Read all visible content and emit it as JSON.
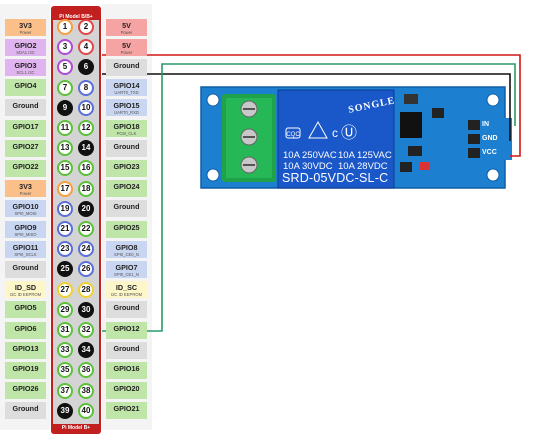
{
  "header": {
    "model": "Pi Model B/B+"
  },
  "footer": {
    "model": "Pi Model B+"
  },
  "pins": [
    {
      "l": "3V3",
      "ls": "Power",
      "r": "5V",
      "rs": "Power",
      "lc": "#fbbf8a",
      "rc": "#f6a3a3",
      "lp": "#f5a040",
      "rp": "#e14747",
      "ld": false,
      "rd": false
    },
    {
      "l": "GPIO2",
      "ls": "SDA1 I2C",
      "r": "5V",
      "rs": "Power",
      "lc": "#e0b4ee",
      "rc": "#f6a3a3",
      "lp": "#b24ad6",
      "rp": "#e14747",
      "ld": false,
      "rd": false
    },
    {
      "l": "GPIO3",
      "ls": "SCL1 I2C",
      "r": "Ground",
      "rs": "",
      "lc": "#e0b4ee",
      "rc": "#dddddd",
      "lp": "#b24ad6",
      "rp": "#111111",
      "ld": false,
      "rd": true
    },
    {
      "l": "GPIO4",
      "ls": "",
      "r": "GPIO14",
      "rs": "UART0_TXD",
      "lc": "#bfe6a8",
      "rc": "#c9d6f2",
      "lp": "#5cc13a",
      "rp": "#5a6fd8",
      "ld": false,
      "rd": false
    },
    {
      "l": "Ground",
      "ls": "",
      "r": "GPIO15",
      "rs": "UART0_RXD",
      "lc": "#dddddd",
      "rc": "#c9d6f2",
      "lp": "#111111",
      "rp": "#5a6fd8",
      "ld": true,
      "rd": false
    },
    {
      "l": "GPIO17",
      "ls": "",
      "r": "GPIO18",
      "rs": "PCM_CLK",
      "lc": "#bfe6a8",
      "rc": "#bfe6a8",
      "lp": "#5cc13a",
      "rp": "#5cc13a",
      "ld": false,
      "rd": false
    },
    {
      "l": "GPIO27",
      "ls": "",
      "r": "Ground",
      "rs": "",
      "lc": "#bfe6a8",
      "rc": "#dddddd",
      "lp": "#5cc13a",
      "rp": "#111111",
      "ld": false,
      "rd": true
    },
    {
      "l": "GPIO22",
      "ls": "",
      "r": "GPIO23",
      "rs": "",
      "lc": "#bfe6a8",
      "rc": "#bfe6a8",
      "lp": "#5cc13a",
      "rp": "#5cc13a",
      "ld": false,
      "rd": false
    },
    {
      "l": "3V3",
      "ls": "Power",
      "r": "GPIO24",
      "rs": "",
      "lc": "#fbbf8a",
      "rc": "#bfe6a8",
      "lp": "#f5a040",
      "rp": "#5cc13a",
      "ld": false,
      "rd": false
    },
    {
      "l": "GPIO10",
      "ls": "SPI0_MOSI",
      "r": "Ground",
      "rs": "",
      "lc": "#c9d6f2",
      "rc": "#dddddd",
      "lp": "#5a6fd8",
      "rp": "#111111",
      "ld": false,
      "rd": true
    },
    {
      "l": "GPIO9",
      "ls": "SPI0_MISO",
      "r": "GPIO25",
      "rs": "",
      "lc": "#c9d6f2",
      "rc": "#bfe6a8",
      "lp": "#5a6fd8",
      "rp": "#5cc13a",
      "ld": false,
      "rd": false
    },
    {
      "l": "GPIO11",
      "ls": "SPI0_SCLK",
      "r": "GPIO8",
      "rs": "SPI0_CE0_N",
      "lc": "#c9d6f2",
      "rc": "#c9d6f2",
      "lp": "#5a6fd8",
      "rp": "#5a6fd8",
      "ld": false,
      "rd": false
    },
    {
      "l": "Ground",
      "ls": "",
      "r": "GPIO7",
      "rs": "SPI0_CE1_N",
      "lc": "#dddddd",
      "rc": "#c9d6f2",
      "lp": "#111111",
      "rp": "#5a6fd8",
      "ld": true,
      "rd": false
    },
    {
      "l": "ID_SD",
      "ls": "I2C ID EEPROM",
      "r": "ID_SC",
      "rs": "I2C ID EEPROM",
      "lc": "#fdf6c8",
      "rc": "#fdf6c8",
      "lp": "#f0d030",
      "rp": "#f0d030",
      "ld": false,
      "rd": false
    },
    {
      "l": "GPIO5",
      "ls": "",
      "r": "Ground",
      "rs": "",
      "lc": "#bfe6a8",
      "rc": "#dddddd",
      "lp": "#5cc13a",
      "rp": "#111111",
      "ld": false,
      "rd": true
    },
    {
      "l": "GPIO6",
      "ls": "",
      "r": "GPIO12",
      "rs": "",
      "lc": "#bfe6a8",
      "rc": "#bfe6a8",
      "lp": "#5cc13a",
      "rp": "#5cc13a",
      "ld": false,
      "rd": false
    },
    {
      "l": "GPIO13",
      "ls": "",
      "r": "Ground",
      "rs": "",
      "lc": "#bfe6a8",
      "rc": "#dddddd",
      "lp": "#5cc13a",
      "rp": "#111111",
      "ld": false,
      "rd": true
    },
    {
      "l": "GPIO19",
      "ls": "",
      "r": "GPIO16",
      "rs": "",
      "lc": "#bfe6a8",
      "rc": "#bfe6a8",
      "lp": "#5cc13a",
      "rp": "#5cc13a",
      "ld": false,
      "rd": false
    },
    {
      "l": "GPIO26",
      "ls": "",
      "r": "GPIO20",
      "rs": "",
      "lc": "#bfe6a8",
      "rc": "#bfe6a8",
      "lp": "#5cc13a",
      "rp": "#5cc13a",
      "ld": false,
      "rd": false
    },
    {
      "l": "Ground",
      "ls": "",
      "r": "GPIO21",
      "rs": "",
      "lc": "#dddddd",
      "rc": "#bfe6a8",
      "lp": "#111111",
      "rp": "#5cc13a",
      "ld": true,
      "rd": false
    }
  ],
  "relay": {
    "brand": "SONGLE",
    "ratings": [
      "10A 250VAC",
      "10A 125VAC",
      "10A 30VDC",
      "10A 28VDC"
    ],
    "model": "SRD-05VDC-SL-C",
    "pins": [
      "IN",
      "GND",
      "VCC"
    ]
  },
  "colors": {
    "wire_5v": "#d01818",
    "wire_gnd": "#111111",
    "wire_signal": "#2a9a6a",
    "relay_board": "#1d7fd0",
    "relay_body": "#1a57c8"
  }
}
